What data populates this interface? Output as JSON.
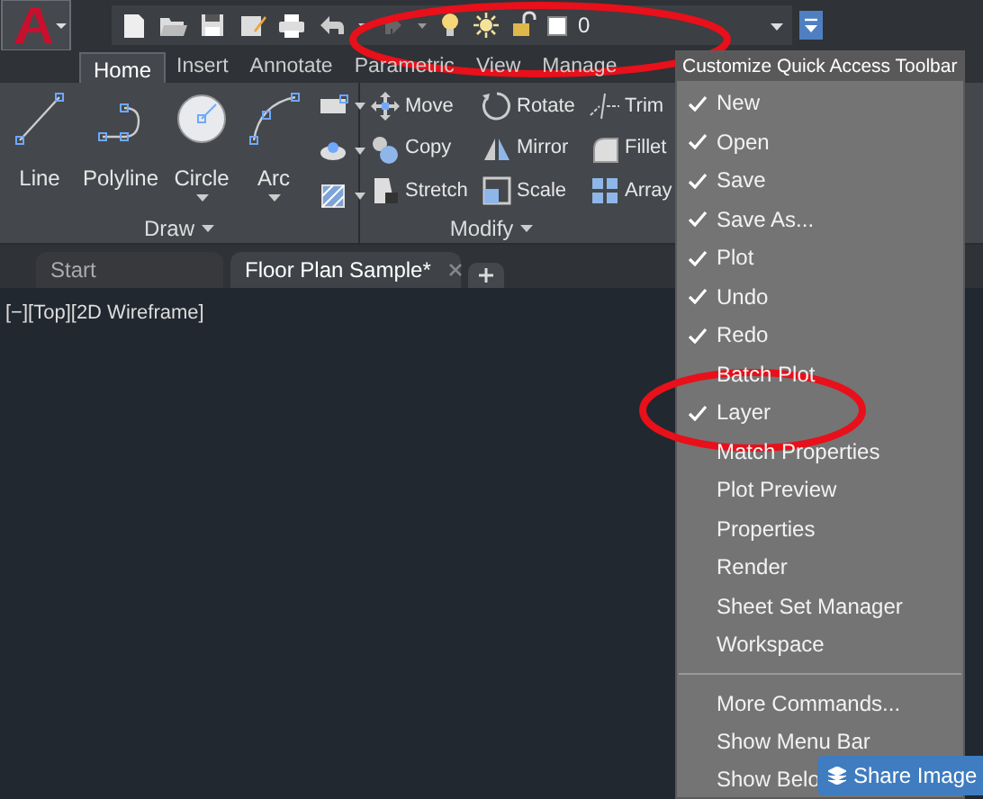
{
  "quick_access": {
    "layer_name": "0"
  },
  "ribbon_tabs": [
    {
      "label": "Home",
      "selected": true
    },
    {
      "label": "Insert",
      "selected": false
    },
    {
      "label": "Annotate",
      "selected": false
    },
    {
      "label": "Parametric",
      "selected": false
    },
    {
      "label": "View",
      "selected": false
    },
    {
      "label": "Manage",
      "selected": false
    }
  ],
  "draw_panel": {
    "title": "Draw",
    "tools": [
      {
        "label": "Line",
        "kind": "line"
      },
      {
        "label": "Polyline",
        "kind": "polyline"
      },
      {
        "label": "Circle",
        "kind": "circle"
      },
      {
        "label": "Arc",
        "kind": "arc"
      }
    ]
  },
  "modify_panel": {
    "title": "Modify",
    "tools": [
      {
        "label": "Move",
        "kind": "move"
      },
      {
        "label": "Copy",
        "kind": "copy"
      },
      {
        "label": "Stretch",
        "kind": "stretch"
      },
      {
        "label": "Rotate",
        "kind": "rotate"
      },
      {
        "label": "Mirror",
        "kind": "mirror"
      },
      {
        "label": "Scale",
        "kind": "scale"
      },
      {
        "label": "Trim",
        "kind": "trim"
      },
      {
        "label": "Fillet",
        "kind": "fillet"
      },
      {
        "label": "Array",
        "kind": "array"
      }
    ]
  },
  "document_tabs": [
    {
      "label": "Start",
      "selected": false
    },
    {
      "label": "Floor Plan Sample*",
      "selected": true
    }
  ],
  "viewport": {
    "label": "[−][Top][2D Wireframe]"
  },
  "menu": {
    "title": "Customize Quick Access Toolbar",
    "items": [
      {
        "label": "New",
        "checked": true
      },
      {
        "label": "Open",
        "checked": true
      },
      {
        "label": "Save",
        "checked": true
      },
      {
        "label": "Save As...",
        "checked": true
      },
      {
        "label": "Plot",
        "checked": true
      },
      {
        "label": "Undo",
        "checked": true
      },
      {
        "label": "Redo",
        "checked": true
      },
      {
        "label": "Batch Plot",
        "checked": false
      },
      {
        "label": "Layer",
        "checked": true
      },
      {
        "label": "Match Properties",
        "checked": false
      },
      {
        "label": "Plot Preview",
        "checked": false
      },
      {
        "label": "Properties",
        "checked": false
      },
      {
        "label": "Render",
        "checked": false
      },
      {
        "label": "Sheet Set Manager",
        "checked": false
      },
      {
        "label": "Workspace",
        "checked": false
      }
    ],
    "extra_items": [
      {
        "label": "More Commands..."
      },
      {
        "label": "Show Menu Bar"
      },
      {
        "label": "Show Belo"
      }
    ]
  },
  "share_button": {
    "label": "Share Image"
  }
}
